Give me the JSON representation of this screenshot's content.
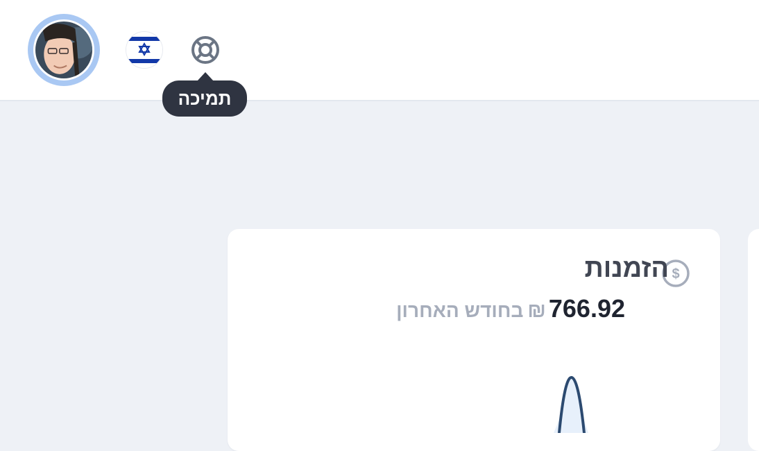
{
  "header": {
    "support_tooltip": "תמיכה",
    "icons": {
      "avatar": "user-avatar",
      "flag": "israel-flag-icon",
      "support": "lifebuoy-icon"
    }
  },
  "card": {
    "title": "הזמנות",
    "value": "766.92",
    "currency": "₪",
    "period": "בחודש האחרון",
    "icon": "dollar-circle-icon"
  },
  "colors": {
    "background": "#eef1f6",
    "tooltip_bg": "#2f3441",
    "avatar_ring": "#a9c8f3",
    "chart_line": "#2c4a70",
    "chart_fill": "#e7f0fb"
  }
}
